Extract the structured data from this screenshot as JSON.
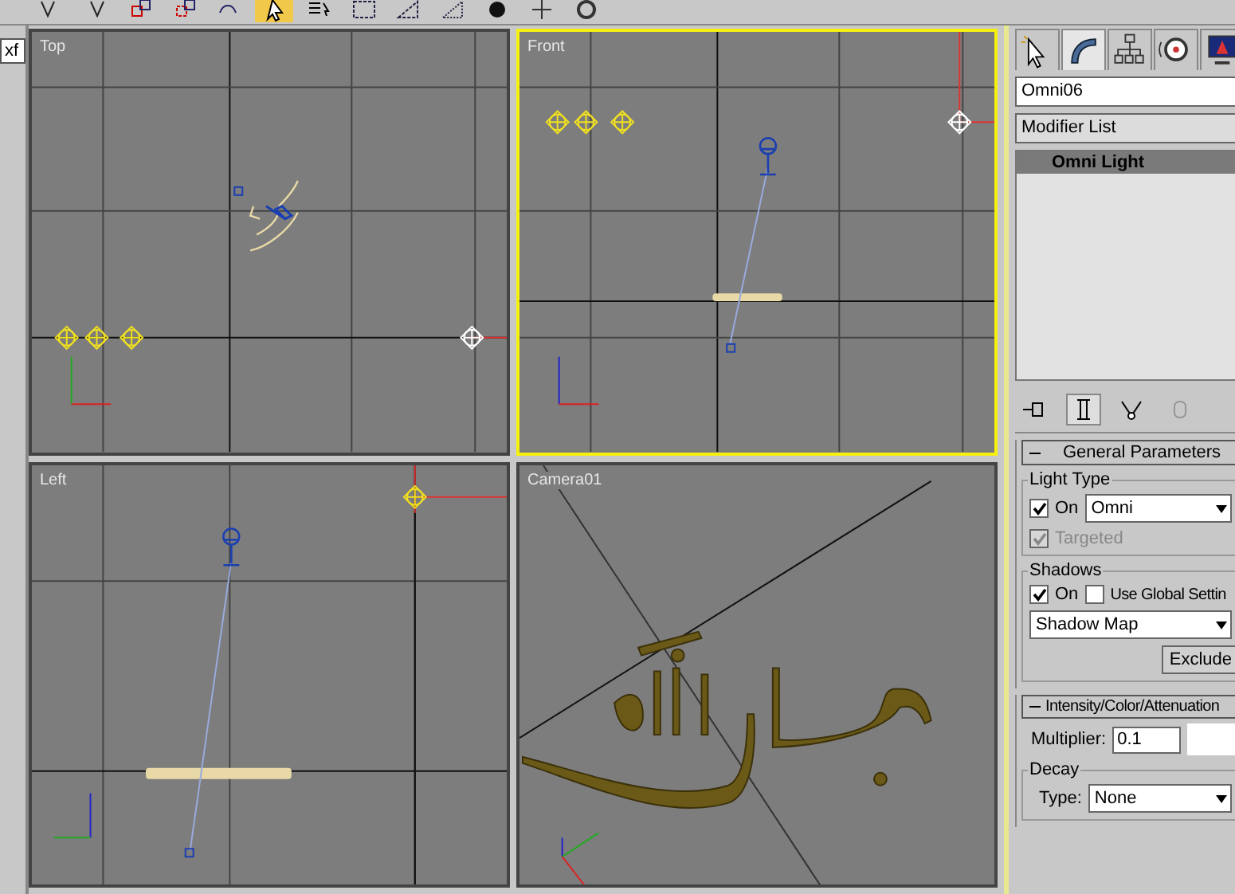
{
  "toolbar": {
    "tools": [
      {
        "selected": false
      },
      {
        "selected": false
      },
      {
        "selected": false
      },
      {
        "selected": false
      },
      {
        "selected": false
      },
      {
        "selected": true
      },
      {
        "selected": false
      },
      {
        "selected": false
      },
      {
        "selected": false
      },
      {
        "selected": false
      },
      {
        "selected": false
      },
      {
        "selected": false
      },
      {
        "selected": false
      }
    ]
  },
  "side_field": {
    "value": "xf"
  },
  "viewports": [
    {
      "label": "Top",
      "kind": "top",
      "selected": false
    },
    {
      "label": "Front",
      "kind": "front",
      "selected": true
    },
    {
      "label": "Left",
      "kind": "left",
      "selected": false
    },
    {
      "label": "Camera01",
      "kind": "camera",
      "selected": false
    }
  ],
  "command_panel": {
    "tabs": [
      {
        "selected": false
      },
      {
        "selected": true
      },
      {
        "selected": false
      },
      {
        "selected": false
      },
      {
        "selected": false
      }
    ],
    "object_name": "Omni06",
    "modifier_list": "Modifier List",
    "stack": [
      {
        "label": "Omni Light",
        "selected": true
      }
    ],
    "stack_buttons": [
      {
        "selected": false,
        "disabled": false
      },
      {
        "selected": true,
        "disabled": false
      },
      {
        "selected": false,
        "disabled": false
      },
      {
        "selected": false,
        "disabled": true
      }
    ],
    "rollouts": [
      {
        "title": "General Parameters",
        "expanded": true,
        "kind": "general",
        "light_type": {
          "title": "Light Type",
          "on_label": "On",
          "on": true,
          "type": "Omni",
          "targeted_label": "Targeted",
          "targeted": true,
          "targeted_disabled": true
        },
        "shadows": {
          "title": "Shadows",
          "on_label": "On",
          "on": true,
          "global_label": "Use Global Settin",
          "global": false,
          "type": "Shadow Map",
          "exclude": "Exclude"
        }
      },
      {
        "title": "Intensity/Color/Attenuation",
        "expanded": true,
        "kind": "intensity",
        "multiplier_label": "Multiplier:",
        "multiplier": "0.1",
        "color": "#ffffff",
        "decay": {
          "title": "Decay",
          "type_label": "Type:",
          "type": "None"
        }
      }
    ]
  }
}
